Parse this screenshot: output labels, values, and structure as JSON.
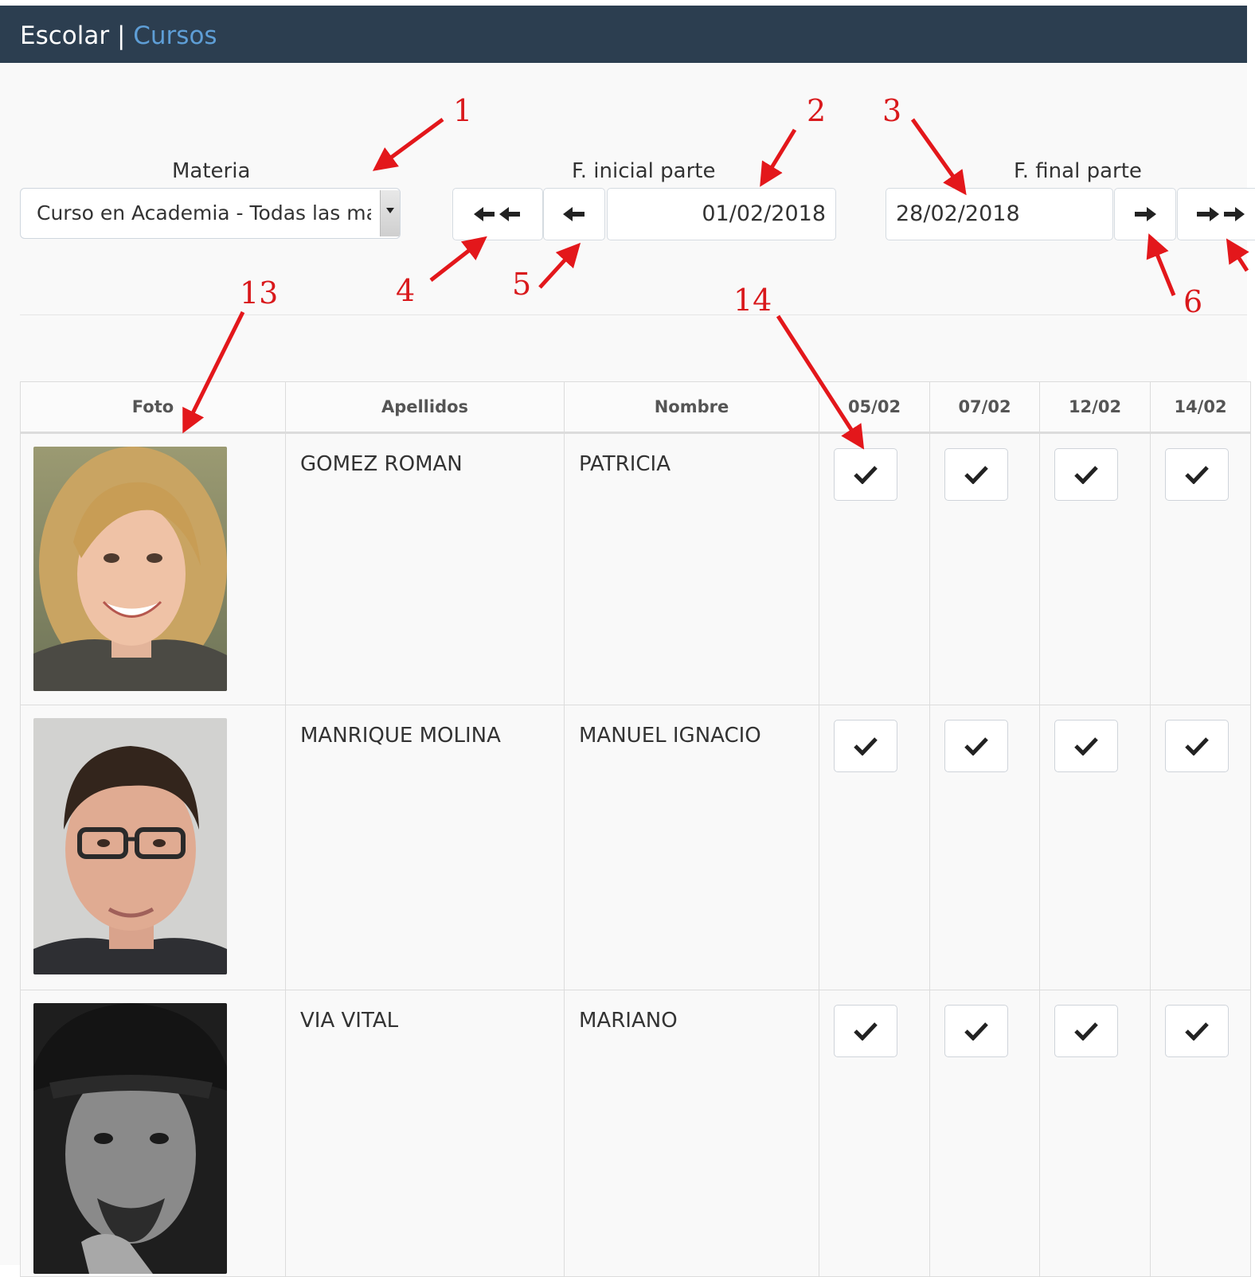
{
  "header": {
    "brand": "Escolar",
    "separator": " | ",
    "section": "Cursos"
  },
  "filters": {
    "materia_label": "Materia",
    "materia_value": "Curso en Academia - Todas las ma",
    "fecha_inicial_label": "F. inicial parte",
    "fecha_inicial_value": "01/02/2018",
    "fecha_final_label": "F. final parte",
    "fecha_final_value": "28/02/2018"
  },
  "table": {
    "headers": {
      "foto": "Foto",
      "apellidos": "Apellidos",
      "nombre": "Nombre"
    },
    "dates": [
      "05/02",
      "07/02",
      "12/02",
      "14/02"
    ],
    "rows": [
      {
        "apellidos": "GOMEZ ROMAN",
        "nombre": "PATRICIA",
        "attendance": [
          true,
          true,
          true,
          true
        ]
      },
      {
        "apellidos": "MANRIQUE MOLINA",
        "nombre": "MANUEL IGNACIO",
        "attendance": [
          true,
          true,
          true,
          true
        ]
      },
      {
        "apellidos": "VIA VITAL",
        "nombre": "MARIANO",
        "attendance": [
          true,
          true,
          true,
          true
        ]
      }
    ]
  },
  "annotations": [
    "1",
    "2",
    "3",
    "4",
    "5",
    "6",
    "13",
    "14"
  ],
  "colors": {
    "topbar": "#2c3e50",
    "brand_accent": "#5e9ed6",
    "annotation": "#d9191c",
    "background": "#f9f9f9"
  }
}
